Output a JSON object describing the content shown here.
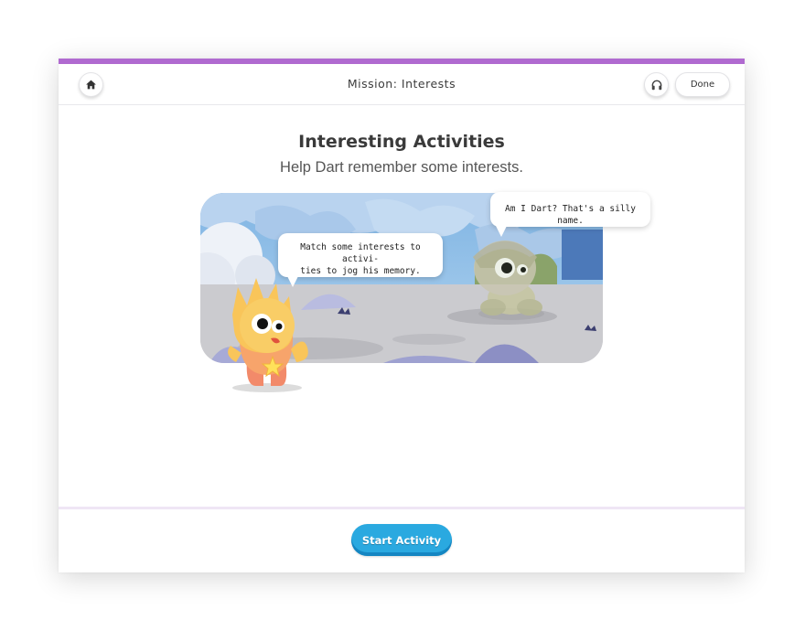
{
  "header": {
    "title": "Mission: Interests",
    "done_label": "Done",
    "home_icon": "home-icon",
    "audio_icon": "headphones-icon"
  },
  "activity": {
    "title": "Interesting Activities",
    "subtitle": "Help Dart remember some interests."
  },
  "scene": {
    "bubble_left_line1": "Match some interests to activi-",
    "bubble_left_line2": "ties to jog his memory.",
    "bubble_right": "Am I Dart? That's a silly name."
  },
  "footer": {
    "start_label": "Start Activity"
  },
  "colors": {
    "accent": "#b06ad0",
    "button": "#2aa9e0"
  }
}
